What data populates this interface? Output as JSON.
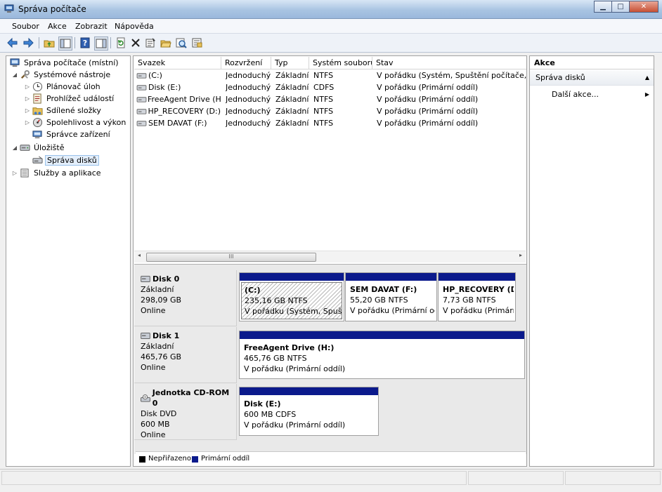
{
  "window": {
    "title": "Správa počítače"
  },
  "menu": [
    {
      "label": "Soubor"
    },
    {
      "label": "Akce"
    },
    {
      "label": "Zobrazit"
    },
    {
      "label": "Nápověda"
    }
  ],
  "toolbar": {
    "icons": [
      "back-arrow-icon",
      "forward-arrow-icon",
      "up-folder-icon",
      "show-hide-tree-icon",
      "help-icon",
      "show-hide-action-pane-icon",
      "refresh-icon",
      "delete-icon",
      "properties-icon",
      "open-folder-icon",
      "search-icon",
      "export-list-icon"
    ]
  },
  "tree": [
    {
      "label": "Správa počítače (místní)",
      "icon": "computer-icon"
    },
    {
      "label": "Systémové nástroje",
      "icon": "tools-icon"
    },
    {
      "label": "Plánovač úloh",
      "icon": "clock-icon"
    },
    {
      "label": "Prohlížeč událostí",
      "icon": "event-viewer-icon"
    },
    {
      "label": "Sdílené složky",
      "icon": "shared-folder-icon"
    },
    {
      "label": "Spolehlivost a výkon",
      "icon": "performance-icon"
    },
    {
      "label": "Správce zařízení",
      "icon": "device-manager-icon"
    },
    {
      "label": "Úložiště",
      "icon": "storage-icon"
    },
    {
      "label": "Správa disků",
      "icon": "disk-management-icon"
    },
    {
      "label": "Služby a aplikace",
      "icon": "services-icon"
    }
  ],
  "volumes": {
    "columns": [
      "Svazek",
      "Rozvržení",
      "Typ",
      "Systém souborů",
      "Stav"
    ],
    "rows": [
      [
        "(C:)",
        "Jednoduchý",
        "Základní",
        "NTFS",
        "V pořádku (Systém, Spuštění počítače, Stránk"
      ],
      [
        "Disk (E:)",
        "Jednoduchý",
        "Základní",
        "CDFS",
        "V pořádku (Primární oddíl)"
      ],
      [
        "FreeAgent Drive (H:)",
        "Jednoduchý",
        "Základní",
        "NTFS",
        "V pořádku (Primární oddíl)"
      ],
      [
        "HP_RECOVERY (D:)",
        "Jednoduchý",
        "Základní",
        "NTFS",
        "V pořádku (Primární oddíl)"
      ],
      [
        "SEM DAVAT (F:)",
        "Jednoduchý",
        "Základní",
        "NTFS",
        "V pořádku (Primární oddíl)"
      ]
    ],
    "scroll_grip": "III"
  },
  "disks": [
    {
      "name": "Disk 0",
      "type": "Základní",
      "size": "298,09 GB",
      "status": "Online",
      "partitions": [
        {
          "name": "(C:)",
          "size": "235,16 GB NTFS",
          "status": "V pořádku (Systém, Spuště"
        },
        {
          "name": "SEM DAVAT  (F:)",
          "size": "55,20 GB NTFS",
          "status": "V pořádku (Primární odd"
        },
        {
          "name": "HP_RECOVERY  (D:",
          "size": "7,73 GB NTFS",
          "status": "V pořádku (Primárn"
        }
      ]
    },
    {
      "name": "Disk 1",
      "type": "Základní",
      "size": "465,76 GB",
      "status": "Online",
      "partitions": [
        {
          "name": "FreeAgent Drive  (H:)",
          "size": "465,76 GB NTFS",
          "status": "V pořádku (Primární oddíl)"
        }
      ]
    },
    {
      "name": "Jednotka CD-ROM 0",
      "type": "Disk DVD",
      "size": "600 MB",
      "status": "Online",
      "partitions": [
        {
          "name": "Disk  (E:)",
          "size": "600 MB CDFS",
          "status": "V pořádku (Primární oddíl)"
        }
      ]
    }
  ],
  "legend": [
    {
      "label": "Nepřiřazeno",
      "color": "#000000"
    },
    {
      "label": "Primární oddíl",
      "color": "#0b1a8c"
    }
  ],
  "actions": {
    "header": "Akce",
    "section": "Správa disků",
    "item": "Další akce..."
  }
}
